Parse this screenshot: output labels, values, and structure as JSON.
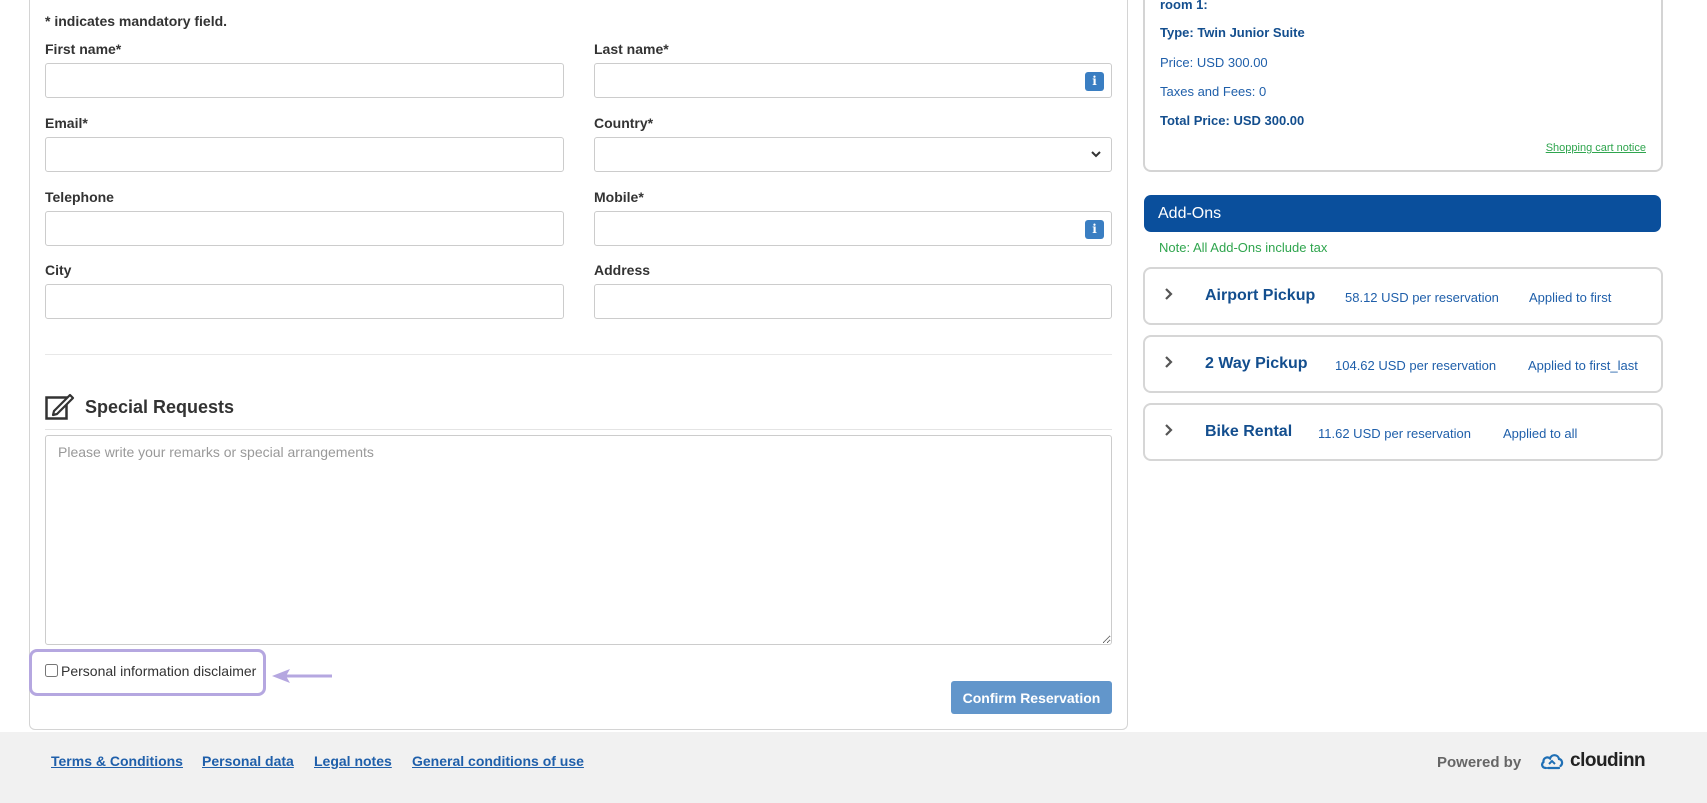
{
  "form": {
    "mandatory_note": "* indicates mandatory field.",
    "first_name": {
      "label": "First name*",
      "value": ""
    },
    "last_name": {
      "label": "Last name*",
      "value": ""
    },
    "email": {
      "label": "Email*",
      "value": ""
    },
    "country": {
      "label": "Country*",
      "value": ""
    },
    "telephone": {
      "label": "Telephone",
      "value": ""
    },
    "mobile": {
      "label": "Mobile*",
      "value": ""
    },
    "city": {
      "label": "City",
      "value": ""
    },
    "address": {
      "label": "Address",
      "value": ""
    },
    "info_glyph": "i"
  },
  "special_requests": {
    "title": "Special Requests",
    "placeholder": "Please write your remarks or special arrangements",
    "value": ""
  },
  "disclaimer": {
    "label": "Personal information disclaimer",
    "checked": false
  },
  "confirm_button": "Confirm Reservation",
  "summary": {
    "room": "room 1:",
    "type": "Type: Twin Junior Suite",
    "price": "Price: USD 300.00",
    "taxes": "Taxes and Fees: 0",
    "total": "Total Price: USD 300.00",
    "cart_notice": "Shopping cart notice"
  },
  "addons": {
    "header": "Add-Ons",
    "note": "Note: All Add-Ons include tax",
    "items": [
      {
        "name": "Airport Pickup",
        "price": "58.12 USD per reservation",
        "applied": "Applied to first"
      },
      {
        "name": "2 Way Pickup",
        "price": "104.62 USD per reservation",
        "applied": "Applied to first_last"
      },
      {
        "name": "Bike Rental",
        "price": "11.62 USD per reservation",
        "applied": "Applied to all"
      }
    ]
  },
  "footer": {
    "links": [
      "Terms & Conditions",
      "Personal data",
      "Legal notes",
      "General conditions of use"
    ],
    "powered_by": "Powered by",
    "brand": "cloudinn"
  },
  "colors": {
    "primary_blue": "#0a4f9c",
    "link_blue": "#1f5faa",
    "button_blue": "#6296cb",
    "note_green": "#2fa54e",
    "highlight_purple": "#b5a7e0"
  },
  "icons": {
    "info": "info-icon",
    "select_chevron": "chevron-down-icon",
    "edit": "edit-icon",
    "expand": "chevron-right-icon",
    "arrow": "arrow-left-icon",
    "logo": "cloud-icon"
  }
}
